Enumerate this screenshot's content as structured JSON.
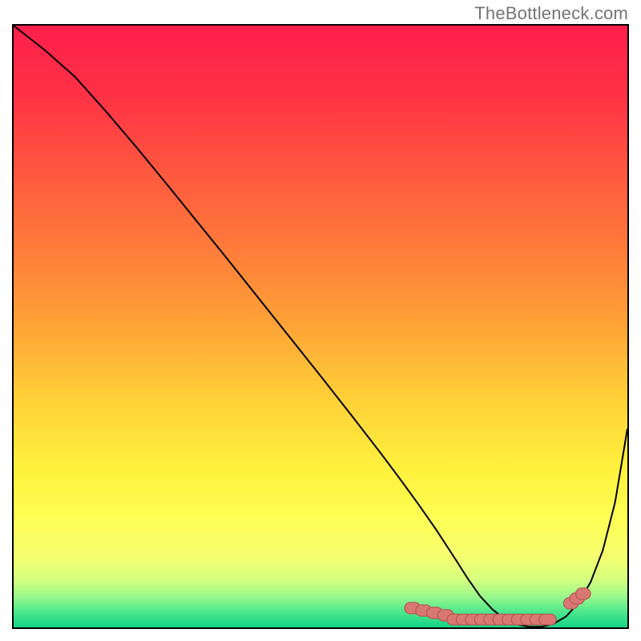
{
  "watermark": "TheBottleneck.com",
  "colors": {
    "gradient_stops": [
      {
        "offset": 0.0,
        "color": "#ff1f4b"
      },
      {
        "offset": 0.12,
        "color": "#ff3345"
      },
      {
        "offset": 0.25,
        "color": "#ff5a3f"
      },
      {
        "offset": 0.38,
        "color": "#ff7e3a"
      },
      {
        "offset": 0.5,
        "color": "#ffa436"
      },
      {
        "offset": 0.62,
        "color": "#ffd038"
      },
      {
        "offset": 0.74,
        "color": "#fff23e"
      },
      {
        "offset": 0.82,
        "color": "#feff55"
      },
      {
        "offset": 0.88,
        "color": "#f6ff6e"
      },
      {
        "offset": 0.92,
        "color": "#d6ff7e"
      },
      {
        "offset": 0.95,
        "color": "#97f88c"
      },
      {
        "offset": 0.975,
        "color": "#4be78d"
      },
      {
        "offset": 1.0,
        "color": "#14d487"
      }
    ],
    "curve": "#000000",
    "marker_fill": "#d97772",
    "marker_stroke": "#b65650"
  },
  "chart_data": {
    "type": "line",
    "title": "",
    "xlabel": "",
    "ylabel": "",
    "xlim": [
      0,
      100
    ],
    "ylim": [
      0,
      100
    ],
    "grid": false,
    "legend": false,
    "series": [
      {
        "name": "bottleneck-curve",
        "x": [
          0,
          5,
          10,
          15,
          20,
          25,
          30,
          35,
          40,
          45,
          50,
          55,
          60,
          63,
          66,
          69,
          72,
          74,
          76,
          78,
          80,
          82,
          84,
          86,
          88,
          90,
          92,
          94,
          96,
          98,
          100
        ],
        "y": [
          100,
          96,
          91.5,
          85.8,
          79.8,
          73.6,
          67.3,
          61.0,
          54.6,
          48.2,
          41.8,
          35.3,
          28.7,
          24.6,
          20.4,
          16.0,
          11.3,
          8.1,
          5.2,
          3.0,
          1.4,
          0.5,
          0.1,
          0.1,
          0.6,
          1.8,
          4.0,
          7.5,
          12.8,
          20.8,
          33.0
        ]
      }
    ],
    "markers_segment_a": {
      "name": "points-cluster-a",
      "x": [
        65.0,
        66.8,
        68.6,
        70.4
      ],
      "y": [
        3.2,
        2.8,
        2.4,
        2.0
      ]
    },
    "markers_segment_b": {
      "name": "points-cluster-b",
      "x": [
        72.0,
        73.5,
        75.0,
        76.5,
        78.0,
        79.5,
        81.0,
        82.5,
        84.0,
        85.5,
        87.0
      ],
      "y": [
        1.3,
        1.3,
        1.3,
        1.3,
        1.3,
        1.3,
        1.3,
        1.3,
        1.3,
        1.3,
        1.3
      ]
    },
    "markers_segment_c": {
      "name": "points-cluster-c",
      "x": [
        90.8,
        91.8,
        92.8
      ],
      "y": [
        4.0,
        4.8,
        5.6
      ]
    }
  }
}
